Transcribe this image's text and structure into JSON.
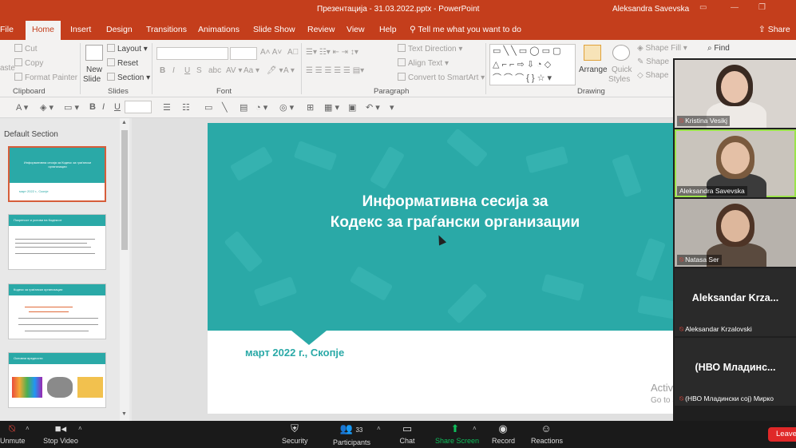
{
  "titlebar": {
    "title": "Презентација - 31.03.2022.pptx  -  PowerPoint",
    "user": "Aleksandra Savevska"
  },
  "ribbon_tabs": [
    "File",
    "Home",
    "Insert",
    "Design",
    "Transitions",
    "Animations",
    "Slide Show",
    "Review",
    "View",
    "Help"
  ],
  "active_tab": "Home",
  "tellme": "Tell me what you want to do",
  "share": "Share",
  "ribbon": {
    "clipboard": {
      "cut": "Cut",
      "copy": "Copy",
      "format_painter": "Format Painter",
      "paste": "aste",
      "label": "Clipboard"
    },
    "slides": {
      "new_slide_1": "New",
      "new_slide_2": "Slide",
      "layout": "Layout",
      "reset": "Reset",
      "section": "Section",
      "label": "Slides"
    },
    "font": {
      "label": "Font"
    },
    "paragraph": {
      "text_direction": "Text Direction",
      "align_text": "Align Text",
      "convert_smartart": "Convert to SmartArt",
      "label": "Paragraph"
    },
    "drawing": {
      "arrange": "Arrange",
      "quick_styles_1": "Quick",
      "quick_styles_2": "Styles",
      "shape_fill": "Shape Fill",
      "shape_outline": "Shape",
      "shape_effects": "Shape",
      "label": "Drawing"
    },
    "editing": {
      "find": "Find"
    }
  },
  "slide_panel": {
    "section_label": "Default Section",
    "thumbnails": [
      {
        "title": "Информативна сесија за Кодекс за граѓански организации",
        "date": "март 2022 г., Скопје"
      },
      {
        "title": "Покреност и услови на Кодексот"
      },
      {
        "title": "Кодекс за граѓански организации"
      },
      {
        "title": "Основни вредности"
      }
    ]
  },
  "slide": {
    "title_line1": "Информативна сесија за",
    "title_line2": "Кодекс за граѓански организации",
    "date": "март 2022 г., Скопје",
    "accent": "#2aa9a7"
  },
  "watermark": {
    "title": "Activate Windows",
    "subtitle": "Go to Settings to activate Windows."
  },
  "participants": [
    {
      "name": "Kristina Vesikj",
      "video": true
    },
    {
      "name": "Aleksandra Savevska",
      "video": true
    },
    {
      "name": "Natasa Ser",
      "video": true
    },
    {
      "name": "Aleksandar Krzalovski",
      "display": "Aleksandar  Krza...",
      "video": false
    },
    {
      "name": "(НВО Младински сој) Мирко",
      "display": "(НВО  Младинс...",
      "video": false
    }
  ],
  "zoom_bar": {
    "unmute": "Unmute",
    "stop_video": "Stop Video",
    "security": "Security",
    "participants": "Participants",
    "participants_count": "33",
    "chat": "Chat",
    "share_screen": "Share Screen",
    "record": "Record",
    "reactions": "Reactions",
    "leave": "Leave"
  },
  "colors": {
    "ppt_red": "#c43e1c",
    "slide_teal": "#2aa9a7",
    "zoom_green": "#0fbd5b",
    "leave_red": "#e02828"
  }
}
